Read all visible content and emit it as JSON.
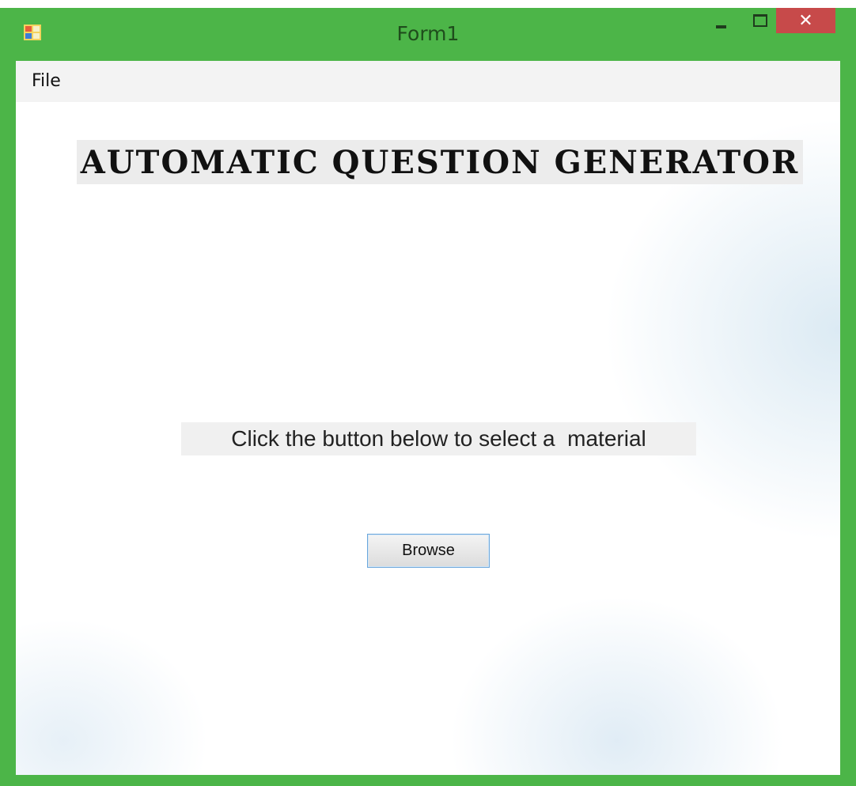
{
  "window": {
    "title": "Form1",
    "close_glyph": "✕",
    "icons": {
      "app": "windows-form-icon",
      "minimize": "minimize-icon",
      "maximize": "maximize-icon",
      "close": "close-icon"
    },
    "frame_color": "#4cb548",
    "close_color": "#c74a4a"
  },
  "menu": {
    "items": [
      {
        "label": "File"
      }
    ]
  },
  "main": {
    "heading": "AUTOMATIC QUESTION GENERATOR",
    "instruction": "Click the button below to select a  material",
    "browse_button": "Browse"
  }
}
